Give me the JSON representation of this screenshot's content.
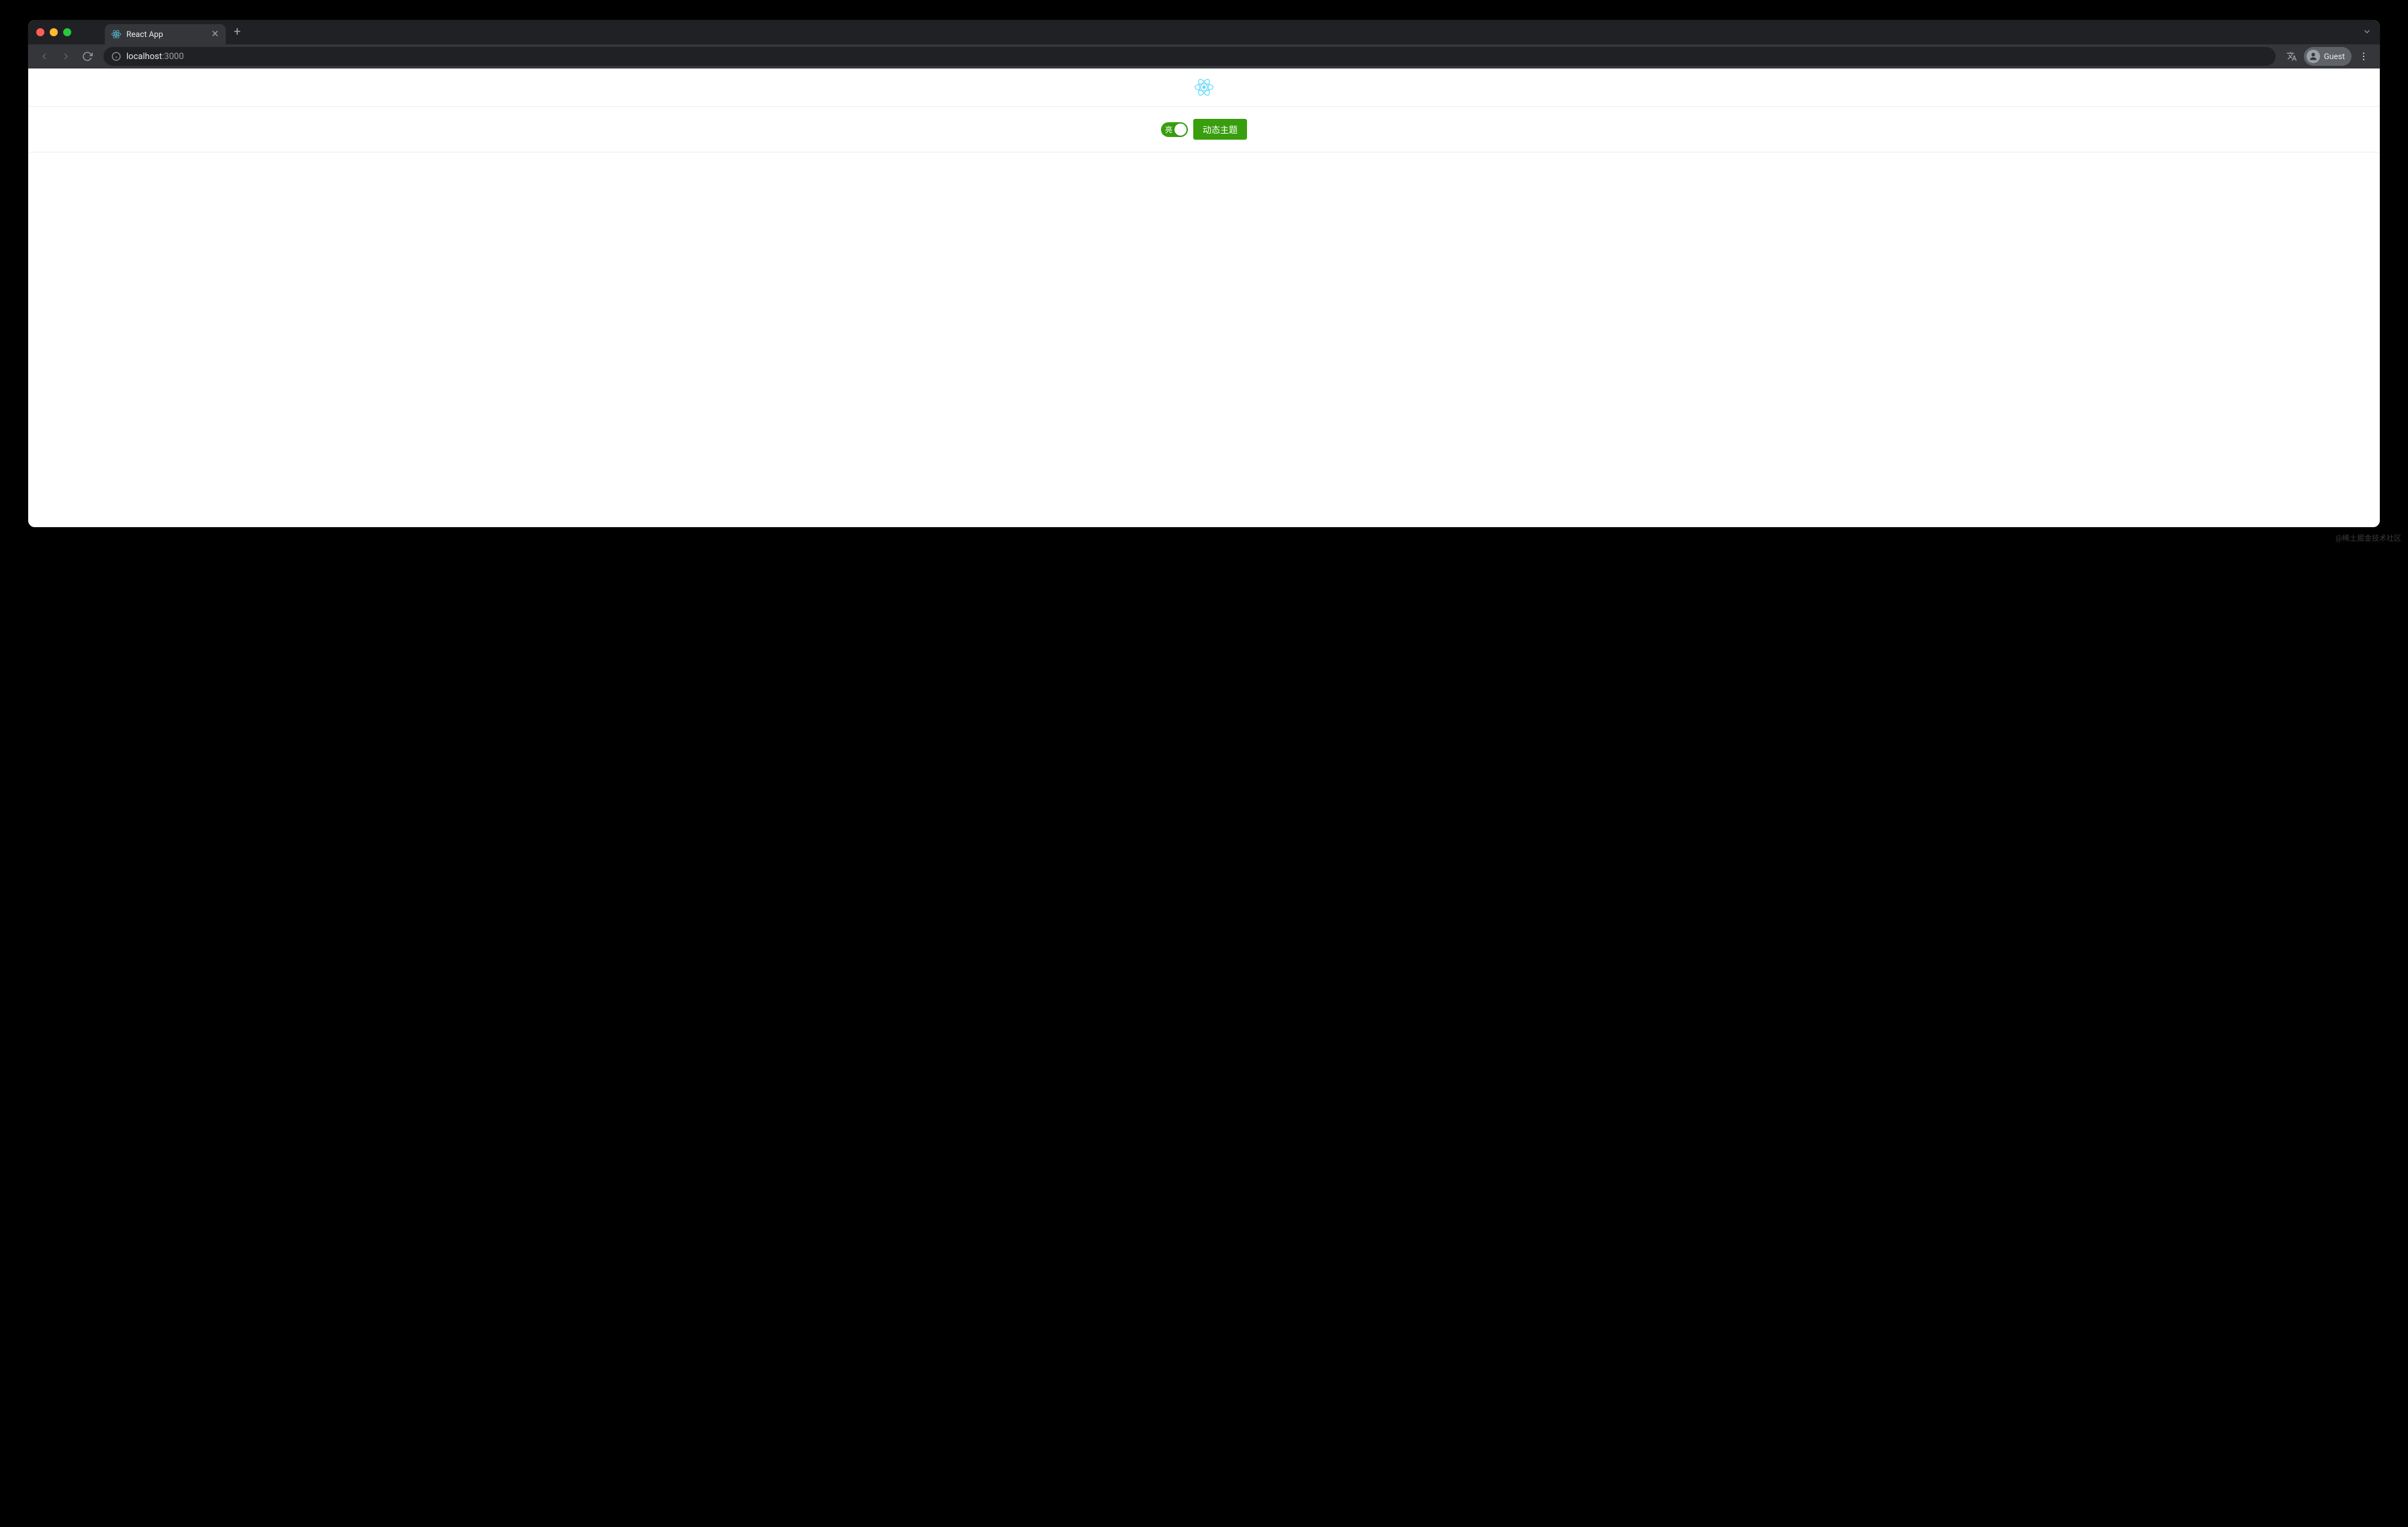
{
  "browser": {
    "tab": {
      "title": "React App"
    },
    "url": {
      "host": "localhost",
      "port": ":3000"
    },
    "profile": {
      "label": "Guest"
    }
  },
  "page": {
    "toggle": {
      "label": "亮"
    },
    "theme_button": "动态主题"
  },
  "watermark": "@稀土掘金技术社区",
  "colors": {
    "accent_green": "#389e0d",
    "react_blue": "#61dafb"
  }
}
